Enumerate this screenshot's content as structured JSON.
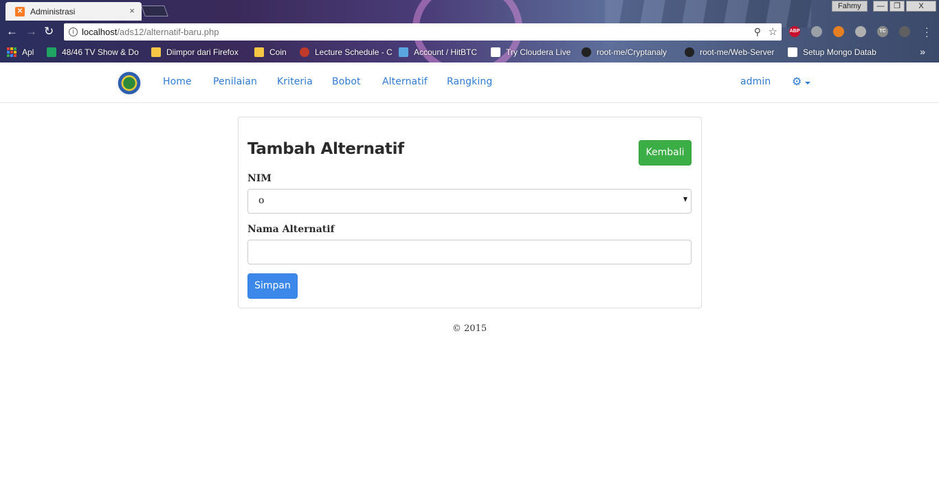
{
  "browser": {
    "tab_title": "Administrasi",
    "tab_close": "×",
    "window_user": "Fahmy",
    "window_buttons": {
      "minimize": "—",
      "maximize": "❐",
      "close": "X"
    },
    "url_host": "localhost",
    "url_path": "/ads12/alternatif-baru.php",
    "bookmarks": [
      {
        "label": "Apl",
        "icon": "apps-icon"
      },
      {
        "label": "48/46 TV Show & Do",
        "icon": "sheets-icon",
        "color": "#1fa463"
      },
      {
        "label": "Diimpor dari Firefox",
        "icon": "folder-icon",
        "color": "#f6c744"
      },
      {
        "label": "Coin",
        "icon": "folder-icon",
        "color": "#f6c744"
      },
      {
        "label": "Lecture Schedule - C",
        "icon": "apple-icon",
        "color": "#c0392b"
      },
      {
        "label": "Account / HitBTC",
        "icon": "fish-icon",
        "color": "#5aa6e0"
      },
      {
        "label": "Try Cloudera Live",
        "icon": "page-icon",
        "color": "#ffffff"
      },
      {
        "label": "root-me/Cryptanaly",
        "icon": "github-icon",
        "color": "#222222"
      },
      {
        "label": "root-me/Web-Server",
        "icon": "github-icon",
        "color": "#222222"
      },
      {
        "label": "Setup Mongo Datab",
        "icon": "page-icon",
        "color": "#ffffff"
      }
    ],
    "bookmarks_more": "»",
    "extensions": [
      {
        "name": "abp-icon",
        "label": "ABP",
        "color": "#c8102e"
      },
      {
        "name": "cloud-icon",
        "label": "",
        "color": "#9aa0a6"
      },
      {
        "name": "ext-orange-icon",
        "label": "",
        "color": "#e67e22"
      },
      {
        "name": "ext-circle-icon",
        "label": "",
        "color": "#b0b0b0"
      },
      {
        "name": "ext-box-icon",
        "label": "TC",
        "color": "#8a8a8a"
      },
      {
        "name": "ext-sync-icon",
        "label": "",
        "color": "#606060"
      }
    ]
  },
  "navbar": {
    "links": [
      "Home",
      "Penilaian",
      "Kriteria",
      "Bobot",
      "Alternatif",
      "Rangking"
    ],
    "user": "admin",
    "accent_color": "#2f7bd4"
  },
  "form": {
    "title": "Tambah Alternatif",
    "back_button": "Kembali",
    "nim_label": "NIM",
    "nim_value": "o",
    "name_label": "Nama Alternatif",
    "name_value": "",
    "submit_button": "Simpan"
  },
  "footer": {
    "text": "© 2015"
  },
  "colors": {
    "back_button": "#3bae45",
    "submit_button": "#3b88ea"
  }
}
